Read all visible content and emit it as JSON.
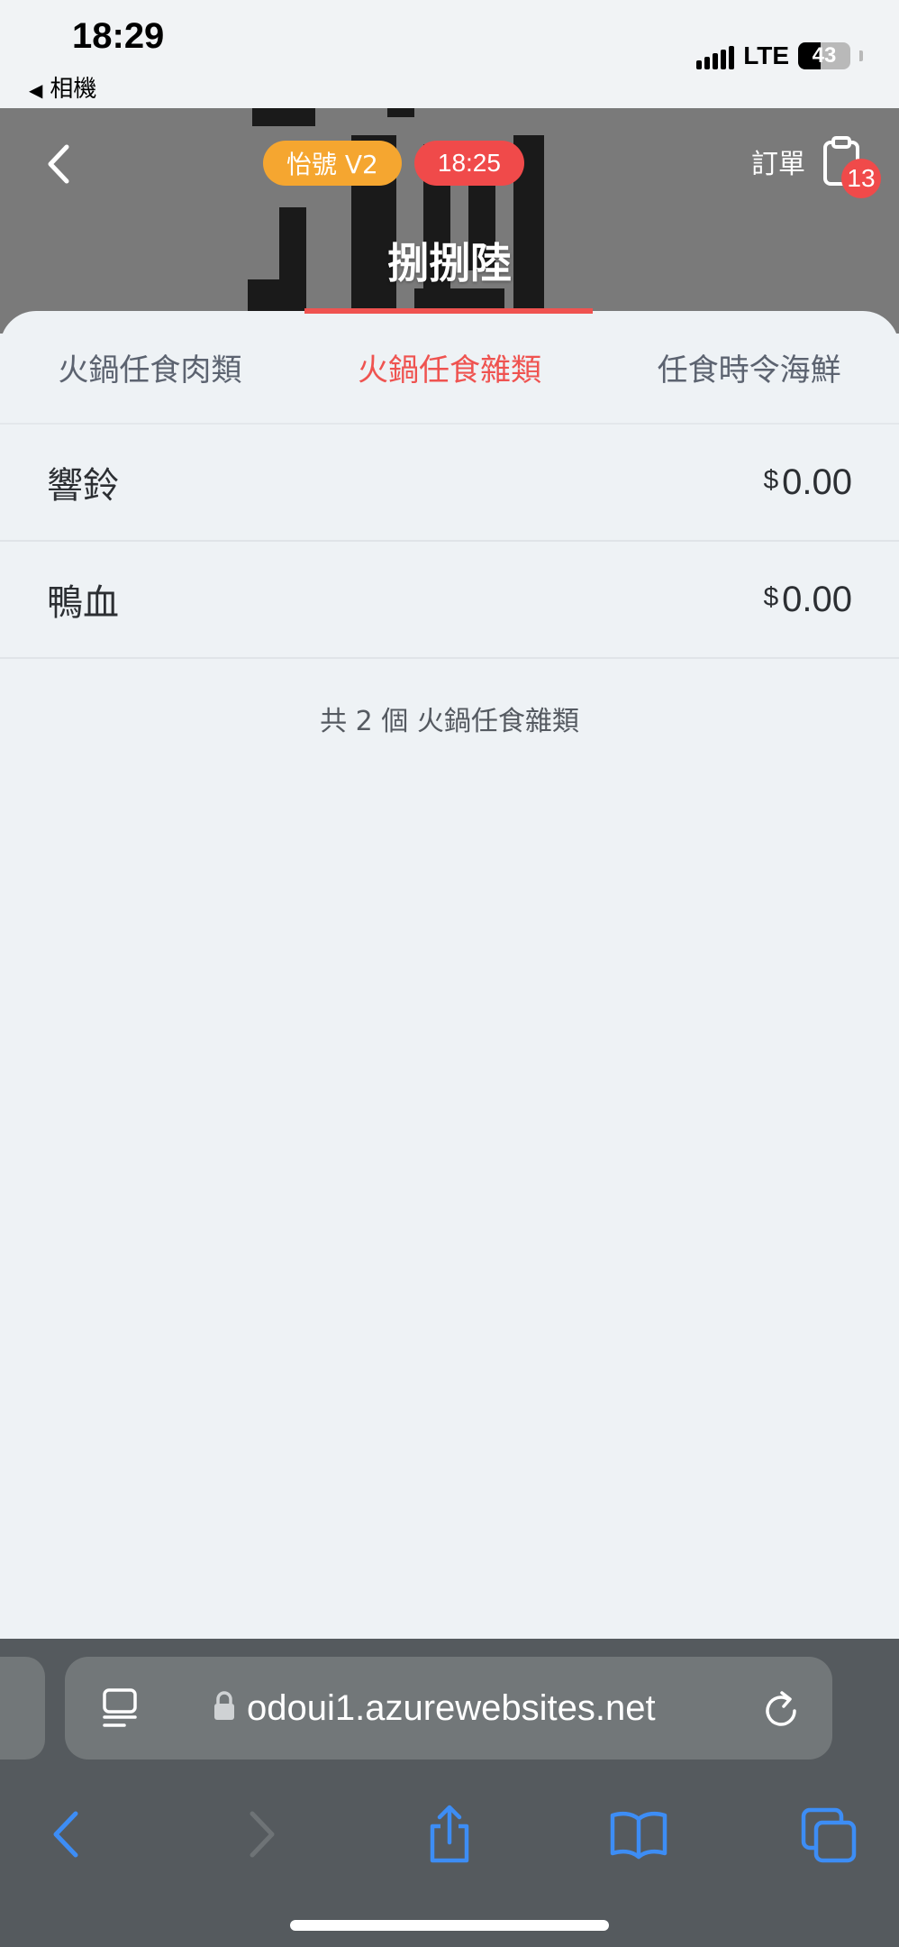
{
  "status_bar": {
    "time": "18:29",
    "back_app": "相機",
    "network": "LTE",
    "battery": "43"
  },
  "header": {
    "badge_store": "怡號 V2",
    "badge_time": "18:25",
    "order_label": "訂單",
    "order_count": "13",
    "store_name": "捌捌陸"
  },
  "tabs": [
    {
      "label": "火鍋任食肉類"
    },
    {
      "label": "火鍋任食雜類"
    },
    {
      "label": "任食時令海鮮"
    }
  ],
  "active_tab": 1,
  "items": [
    {
      "name": "響鈴",
      "currency": "$",
      "price": "0.00"
    },
    {
      "name": "鴨血",
      "currency": "$",
      "price": "0.00"
    }
  ],
  "summary": "共 2 個 火鍋任食雜類",
  "browser": {
    "url": "odoui1.azurewebsites.net"
  },
  "colors": {
    "accent": "#ef5350",
    "badge_orange": "#f5a630",
    "badge_red": "#f04a4a",
    "toolbar": "#555a5e",
    "toolbar_icon_blue": "#3d8df5"
  }
}
